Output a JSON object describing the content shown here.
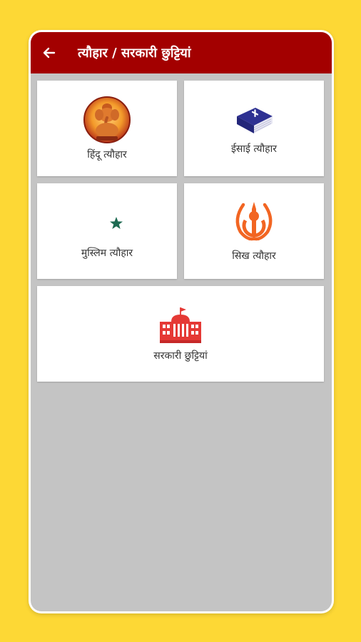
{
  "app": {
    "title": "त्यौहार / सरकारी छुट्टियां"
  },
  "menu": [
    {
      "id": "hindu",
      "label": "हिंदू त्यौहार",
      "icon": "ganesha-icon"
    },
    {
      "id": "christian",
      "label": "ईसाई त्यौहार",
      "icon": "bible-icon"
    },
    {
      "id": "muslim",
      "label": "मुस्लिम त्यौहार",
      "icon": "crescent-star-icon"
    },
    {
      "id": "sikh",
      "label": "सिख त्यौहार",
      "icon": "khanda-icon"
    },
    {
      "id": "govt",
      "label": "सरकारी छुट्टियां",
      "icon": "government-building-icon"
    }
  ],
  "colors": {
    "background": "#fdd835",
    "appbar": "#a30000",
    "content": "#c4c4c4",
    "bible": "#2e3192",
    "crescent": "#1e6b52",
    "khanda": "#f26522",
    "building": "#e53935"
  }
}
